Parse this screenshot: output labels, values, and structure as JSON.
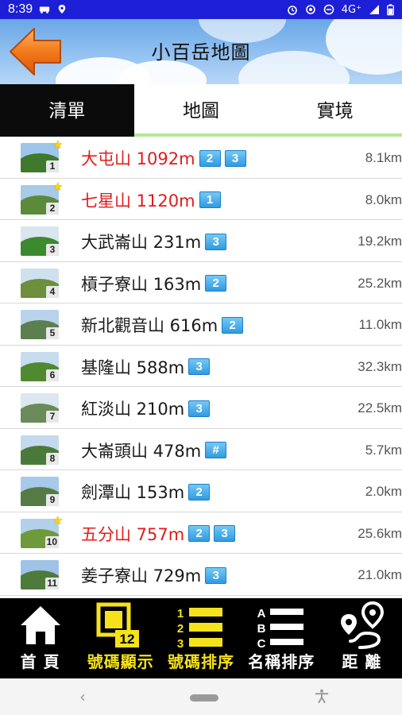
{
  "status_bar": {
    "time": "8:39",
    "network": "4G⁺"
  },
  "header": {
    "title": "小百岳地圖"
  },
  "tabs": [
    {
      "label": "清單",
      "active": true
    },
    {
      "label": "地圖",
      "active": false
    },
    {
      "label": "實境",
      "active": false
    }
  ],
  "mountains": [
    {
      "num": "1",
      "name": "大屯山 1092m",
      "levels": [
        "2",
        "3"
      ],
      "distance": "8.1km",
      "starred": true
    },
    {
      "num": "2",
      "name": "七星山 1120m",
      "levels": [
        "1"
      ],
      "distance": "8.0km",
      "starred": true
    },
    {
      "num": "3",
      "name": "大武崙山 231m",
      "levels": [
        "3"
      ],
      "distance": "19.2km",
      "starred": false
    },
    {
      "num": "4",
      "name": "槓子寮山 163m",
      "levels": [
        "2"
      ],
      "distance": "25.2km",
      "starred": false
    },
    {
      "num": "5",
      "name": "新北觀音山 616m",
      "levels": [
        "2"
      ],
      "distance": "11.0km",
      "starred": false
    },
    {
      "num": "6",
      "name": "基隆山 588m",
      "levels": [
        "3"
      ],
      "distance": "32.3km",
      "starred": false
    },
    {
      "num": "7",
      "name": "紅淡山 210m",
      "levels": [
        "3"
      ],
      "distance": "22.5km",
      "starred": false
    },
    {
      "num": "8",
      "name": "大崙頭山 478m",
      "levels": [
        "#"
      ],
      "distance": "5.7km",
      "starred": false
    },
    {
      "num": "9",
      "name": "劍潭山 153m",
      "levels": [
        "2"
      ],
      "distance": "2.0km",
      "starred": false
    },
    {
      "num": "10",
      "name": "五分山 757m",
      "levels": [
        "2",
        "3"
      ],
      "distance": "25.6km",
      "starred": true
    },
    {
      "num": "11",
      "name": "姜子寮山 729m",
      "levels": [
        "3"
      ],
      "distance": "21.0km",
      "starred": false
    }
  ],
  "toolbar": {
    "home_label": "首 頁",
    "number_display_label": "號碼顯示",
    "number_display_icon_value": "12",
    "number_sort_label": "號碼排序",
    "number_sort_digits": [
      "1",
      "2",
      "3"
    ],
    "name_sort_label": "名稱排序",
    "name_sort_letters": [
      "A",
      "B",
      "C"
    ],
    "distance_label": "距 離"
  },
  "colors": {
    "status_bar": "#1c1fd6",
    "active_tab": "#0b0b0b",
    "tab_underline": "#b6e79a",
    "starred_name": "#e31b1b",
    "toolbar_accent": "#f5e21a",
    "level_badge": "#2f9be2"
  }
}
